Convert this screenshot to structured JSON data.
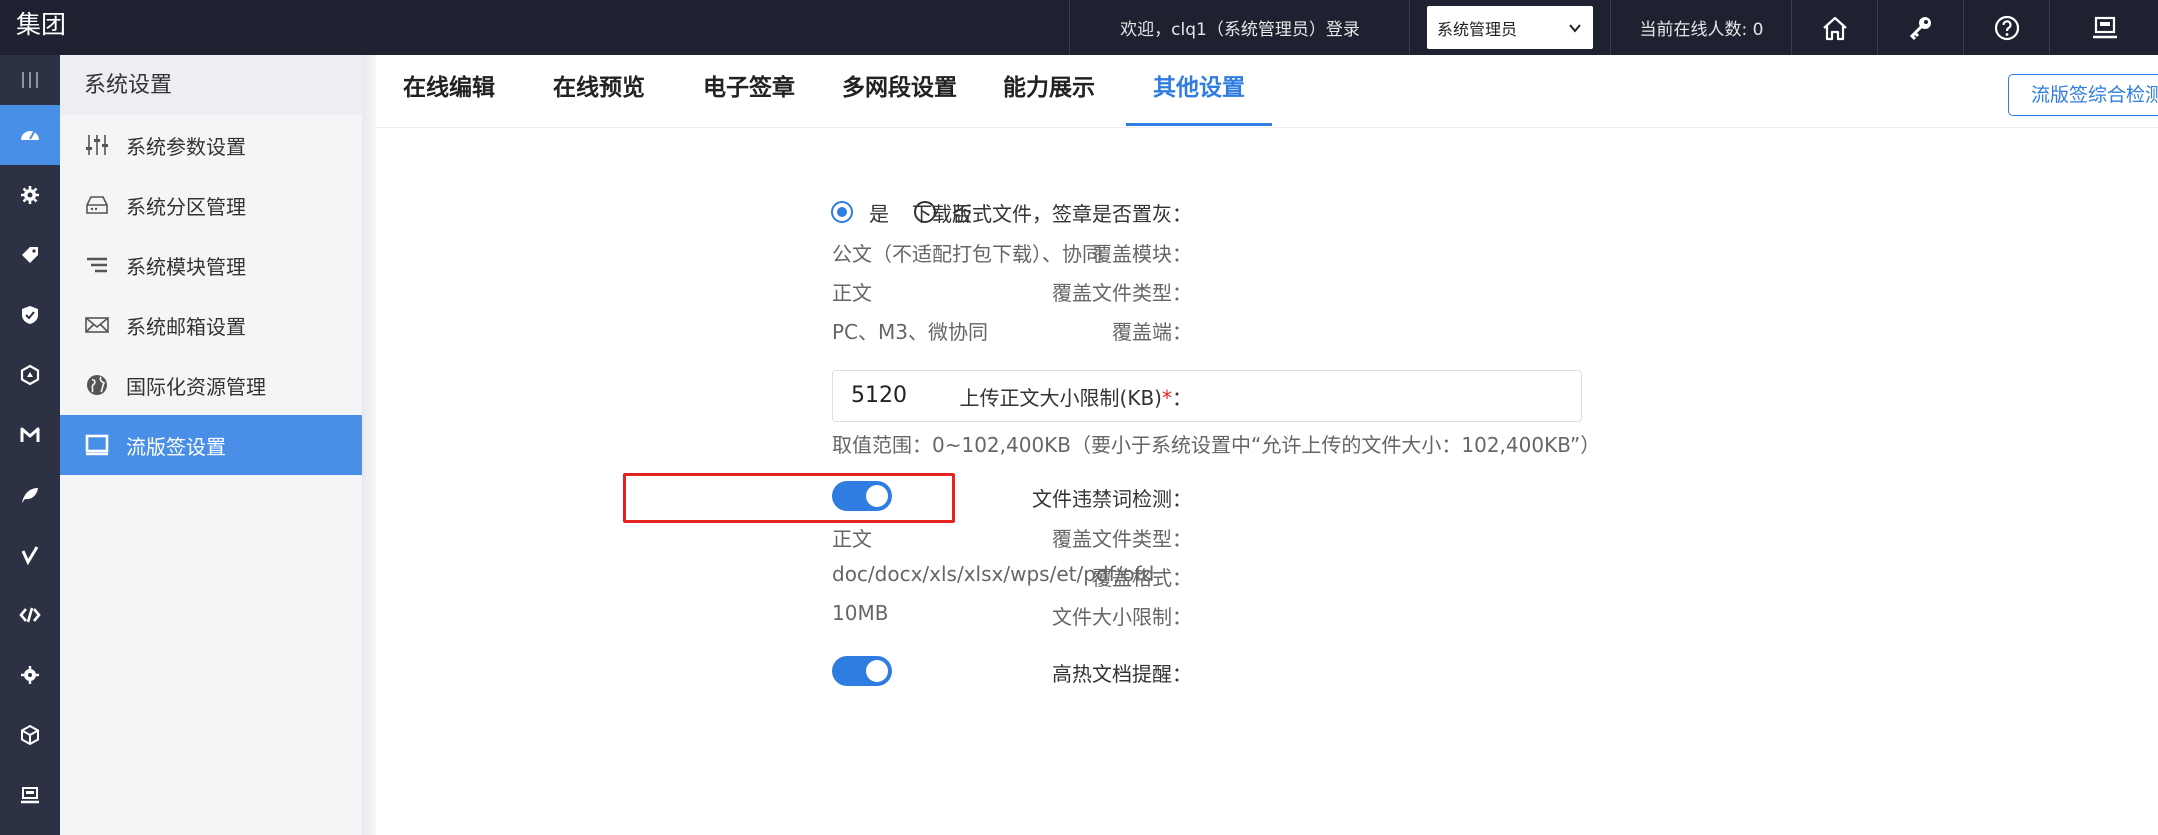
{
  "topbar": {
    "brand": "集团",
    "welcome": "欢迎，clq1（系统管理员）登录",
    "role_selected": "系统管理员",
    "online_count": "当前在线人数: 0"
  },
  "submenu": {
    "title": "系统设置",
    "items": [
      {
        "label": "系统参数设置"
      },
      {
        "label": "系统分区管理"
      },
      {
        "label": "系统模块管理"
      },
      {
        "label": "系统邮箱设置"
      },
      {
        "label": "国际化资源管理"
      },
      {
        "label": "流版签设置"
      }
    ]
  },
  "tabs": [
    {
      "label": "在线编辑"
    },
    {
      "label": "在线预览"
    },
    {
      "label": "电子签章"
    },
    {
      "label": "多网段设置"
    },
    {
      "label": "能力展示"
    },
    {
      "label": "其他设置"
    }
  ],
  "right_button": "流版签综合检测",
  "form": {
    "download_gray": {
      "label": "下载版式文件，签章是否置灰：",
      "yes": "是",
      "no": "否",
      "selected": "是"
    },
    "cover_module": {
      "label": "覆盖模块：",
      "value": "公文（不适配打包下载）、协同"
    },
    "cover_file_type": {
      "label": "覆盖文件类型：",
      "value": "正文"
    },
    "cover_client": {
      "label": "覆盖端：",
      "value": "PC、M3、微协同"
    },
    "upload_limit": {
      "label": "上传正文大小限制(KB)",
      "required": "*",
      "colon": "：",
      "value": "5120",
      "hint": "取值范围：0~102,400KB（要小于系统设置中“允许上传的文件大小：102,400KB”）"
    },
    "forbidden_words": {
      "label": "文件违禁词检测：",
      "enabled": true
    },
    "fw_file_type": {
      "label": "覆盖文件类型：",
      "value": "正文"
    },
    "fw_format": {
      "label": "覆盖格式：",
      "value": "doc/docx/xls/xlsx/wps/et/pdf/ofd"
    },
    "fw_size": {
      "label": "文件大小限制：",
      "value": "10MB"
    },
    "hot_doc": {
      "label": "高热文档提醒：",
      "enabled": true
    }
  },
  "colors": {
    "topbar_bg": "#1e2130",
    "rail_bg": "#2c3143",
    "accent": "#2f7de1",
    "highlight": "#e32222"
  }
}
